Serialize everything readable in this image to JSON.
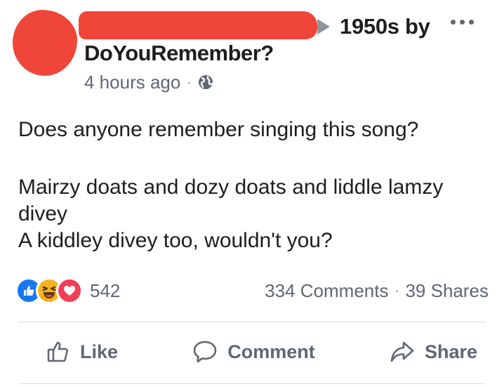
{
  "post": {
    "group_name_line1": "1950s by",
    "group_name_line2": "DoYouRemember?",
    "timestamp": "4 hours ago",
    "meta_separator": "·",
    "privacy_icon": "globe-icon",
    "body_line1": "Does anyone remember singing this song?",
    "body_line2": "Mairzy doats and dozy doats and liddle lamzy divey",
    "body_line3": "A kiddley divey too, wouldn't you?"
  },
  "reactions": {
    "icons": [
      "like-reaction-icon",
      "haha-reaction-icon",
      "love-reaction-icon"
    ],
    "count": "542"
  },
  "stats": {
    "comments": "334 Comments",
    "separator": "·",
    "shares": "39 Shares"
  },
  "actions": {
    "like_label": "Like",
    "comment_label": "Comment",
    "share_label": "Share"
  },
  "colors": {
    "redaction": "#f0463a",
    "like_blue": "#1877f2",
    "love_red": "#f33e58",
    "haha_yellow": "#f7b125",
    "secondary_text": "#606770"
  }
}
